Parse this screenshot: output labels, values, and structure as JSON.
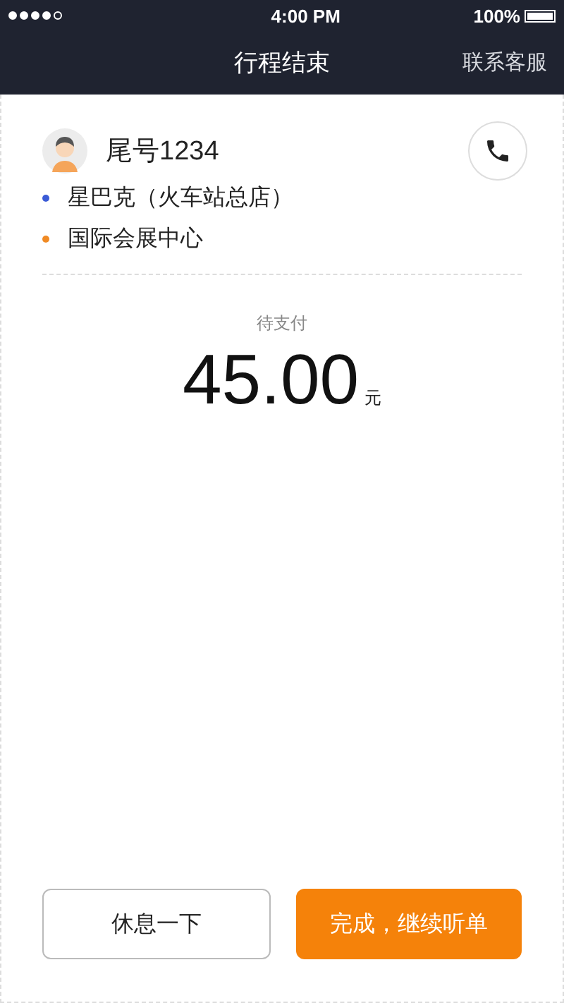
{
  "status_bar": {
    "time": "4:00 PM",
    "battery": "100%"
  },
  "nav": {
    "title": "行程结束",
    "action": "联系客服"
  },
  "passenger": {
    "name": "尾号1234"
  },
  "route": [
    {
      "name": "星巴克（火车站总店）",
      "color": "#3b5bd6"
    },
    {
      "name": "国际会展中心",
      "color": "#f08a24"
    }
  ],
  "payment": {
    "label": "待支付",
    "amount": "45.00",
    "unit": "元"
  },
  "buttons": [
    {
      "label": "休息一下",
      "kind": "secondary"
    },
    {
      "label": "完成，继续听单",
      "kind": "primary"
    }
  ]
}
